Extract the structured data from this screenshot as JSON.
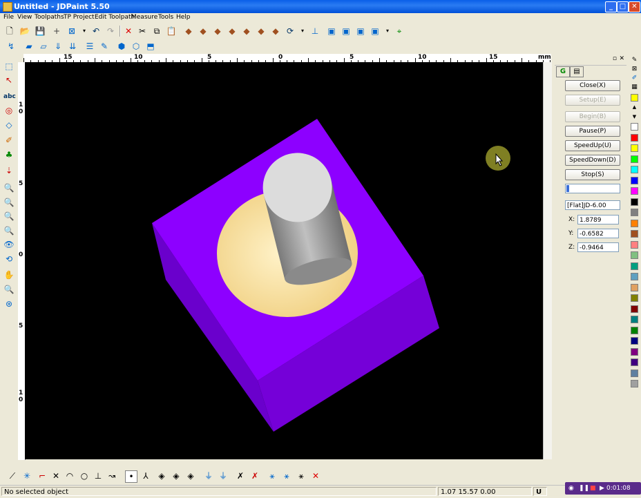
{
  "window": {
    "title": "Untitled - JDPaint 5.50",
    "min_glyph": "_",
    "max_glyph": "□",
    "close_glyph": "✕"
  },
  "menu": [
    "File",
    "View",
    "Toolpaths",
    "TP Project",
    "Edit Toolpath",
    "Measure",
    "Tools",
    "Help"
  ],
  "ruler": {
    "unit": "mm",
    "top_labels": [
      "15",
      "10",
      "5",
      "0",
      "5",
      "10",
      "15"
    ],
    "left_labels": [
      "1",
      "0",
      "5",
      "0",
      "5",
      "1",
      "0"
    ]
  },
  "panel": {
    "tabs": [
      "G",
      "▤"
    ],
    "buttons": {
      "close": "Close(X)",
      "setup": "Setup(E)",
      "begin": "Begin(B)",
      "pause": "Pause(P)",
      "speedup": "SpeedUp(U)",
      "speeddown": "SpeedDown(D)",
      "stop": "Stop(S)"
    },
    "progress": 0.05,
    "tool": "[Flat]JD-6.00",
    "x_label": "X:",
    "x_value": "1.8789",
    "y_label": "Y:",
    "y_value": "-0.6582",
    "z_label": "Z:",
    "z_value": "-0.9464"
  },
  "status": {
    "selection": "No selected object",
    "coords": "1.07 15.57 0.00",
    "mode": "U"
  },
  "recorder": {
    "time": "0:01:08"
  },
  "palette_colors": [
    "#ffffff",
    "#ff0000",
    "#ffff00",
    "#00ff00",
    "#00ffff",
    "#0000ff",
    "#ff00ff",
    "#000000",
    "#808080",
    "#ff8000",
    "#a05020",
    "#ff8080",
    "#80c080",
    "#00a080",
    "#60a0c0",
    "#e0a060",
    "#808000",
    "#800000",
    "#008080",
    "#008000",
    "#000080",
    "#800080",
    "#400080",
    "#6080a0",
    "#a0a0a0"
  ],
  "colors": {
    "stock": "#8b00ff",
    "stock_dark": "#7200d4",
    "cut": "#f8e0a0",
    "tool": "#d8d8d8"
  }
}
